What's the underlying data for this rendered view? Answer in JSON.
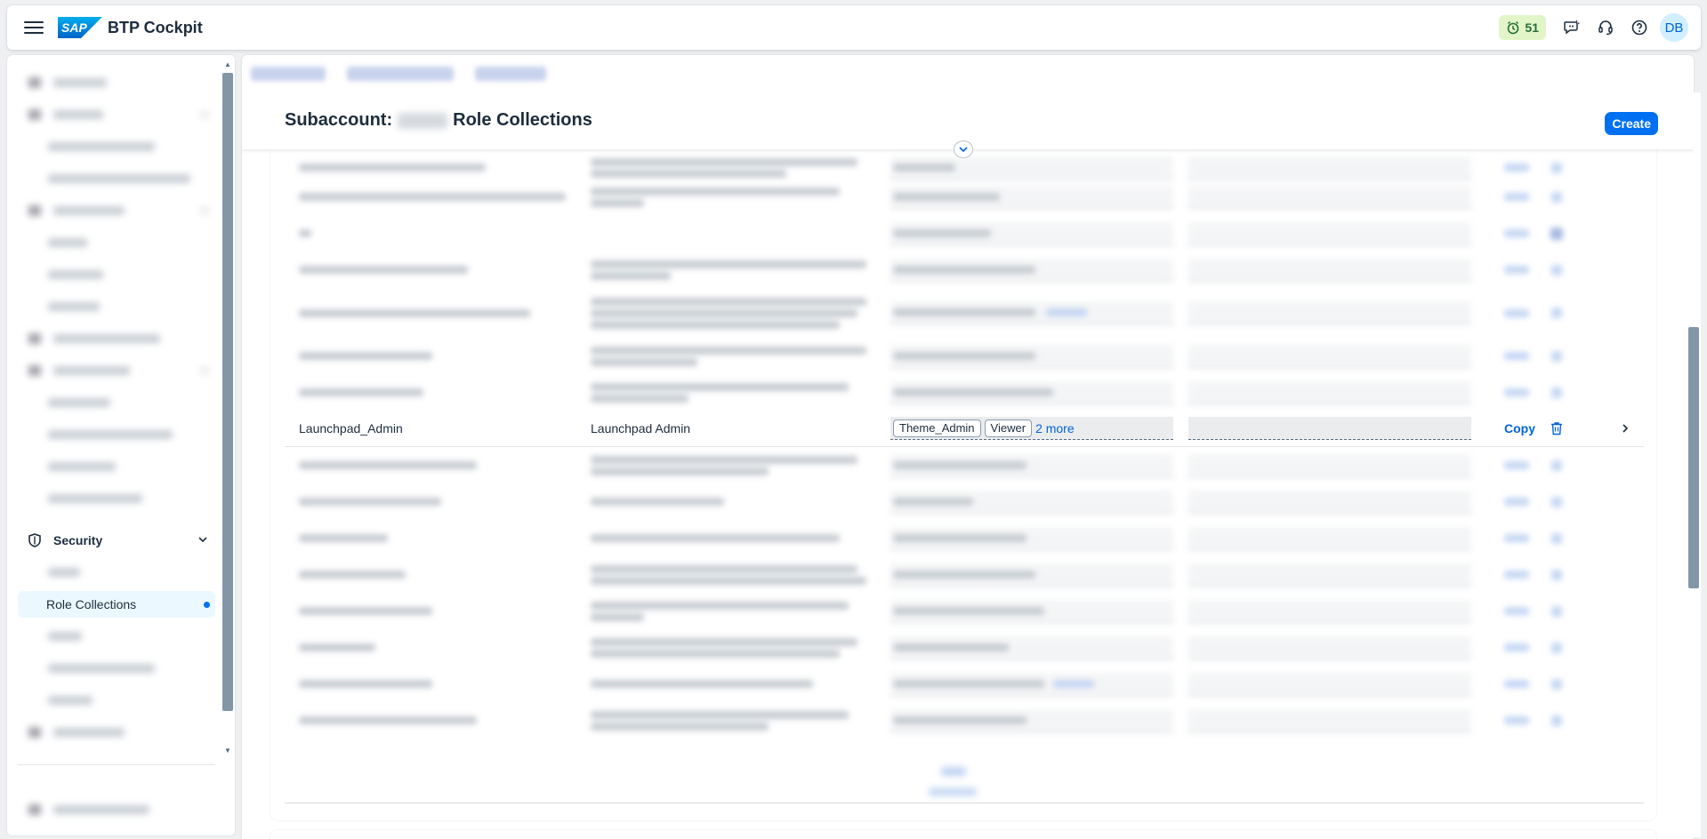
{
  "shell": {
    "logo_text": "SAP",
    "product_title": "BTP Cockpit",
    "notifications_count": "51",
    "avatar_initials": "DB",
    "icons": [
      "menu-icon",
      "notification-icon",
      "feedback-icon",
      "support-icon",
      "help-icon"
    ],
    "accent_color": "#0070f2"
  },
  "sidenav": {
    "security_label": "Security",
    "selected_item_label": "Role Collections",
    "selected_color": "#ebf8ff"
  },
  "page": {
    "title_prefix": "Subaccount:",
    "title_suffix": "Role Collections",
    "create_label": "Create"
  },
  "table": {
    "focused_row": {
      "name": "Launchpad_Admin",
      "description": "Launchpad Admin",
      "roles": [
        "Theme_Admin",
        "Viewer"
      ],
      "more_roles": "2 more",
      "copy_label": "Copy"
    }
  }
}
